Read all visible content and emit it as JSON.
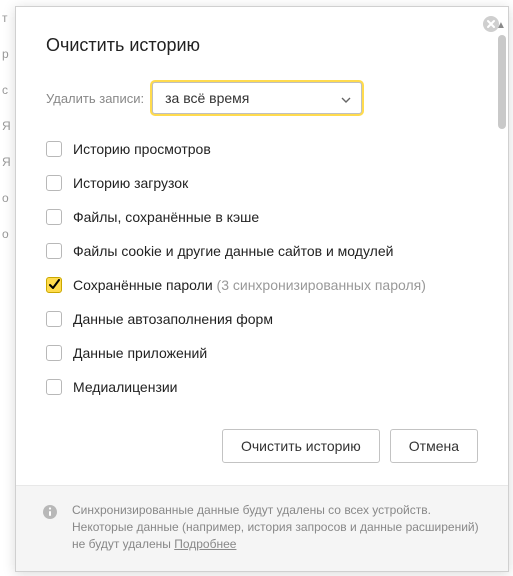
{
  "bg_chars": "т\nр\nс\nЯ\nЯ\nо\nо",
  "dialog": {
    "title": "Очистить историю",
    "period_label": "Удалить записи:",
    "period_value": "за всё время",
    "options": [
      {
        "label": "Историю просмотров",
        "checked": false
      },
      {
        "label": "Историю загрузок",
        "checked": false
      },
      {
        "label": "Файлы, сохранённые в кэше",
        "checked": false
      },
      {
        "label": "Файлы cookie и другие данные сайтов и модулей",
        "checked": false
      },
      {
        "label": "Сохранённые пароли",
        "sub": "(3 синхронизированных пароля)",
        "checked": true
      },
      {
        "label": "Данные автозаполнения форм",
        "checked": false
      },
      {
        "label": "Данные приложений",
        "checked": false
      },
      {
        "label": "Медиалицензии",
        "checked": false
      }
    ],
    "actions": {
      "clear": "Очистить историю",
      "cancel": "Отмена"
    },
    "footer": {
      "text1": "Синхронизированные данные будут удалены со всех устройств. Некоторые данные (например, история запросов и данные расширений) не будут удалены ",
      "link": "Подробнее"
    }
  }
}
